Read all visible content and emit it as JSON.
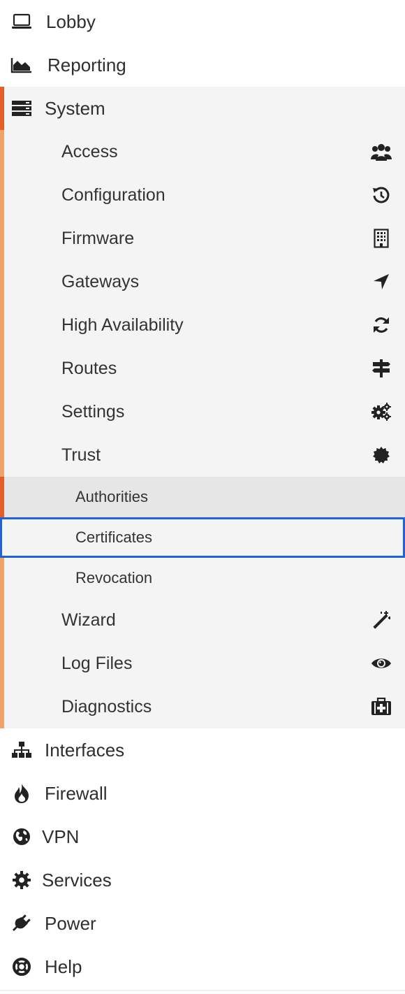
{
  "menu": {
    "top_items": [
      {
        "label": "Lobby",
        "icon": "laptop-icon"
      },
      {
        "label": "Reporting",
        "icon": "area-chart-icon"
      },
      {
        "label": "System",
        "icon": "server-icon"
      }
    ],
    "system_items": [
      {
        "label": "Access",
        "icon": "users-icon"
      },
      {
        "label": "Configuration",
        "icon": "history-icon"
      },
      {
        "label": "Firmware",
        "icon": "building-icon"
      },
      {
        "label": "Gateways",
        "icon": "location-arrow-icon"
      },
      {
        "label": "High Availability",
        "icon": "refresh-icon"
      },
      {
        "label": "Routes",
        "icon": "signpost-icon"
      },
      {
        "label": "Settings",
        "icon": "cogs-icon"
      },
      {
        "label": "Trust",
        "icon": "certificate-icon"
      }
    ],
    "trust_items": [
      {
        "label": "Authorities"
      },
      {
        "label": "Certificates"
      },
      {
        "label": "Revocation"
      }
    ],
    "system_items_after": [
      {
        "label": "Wizard",
        "icon": "magic-wand-icon"
      },
      {
        "label": "Log Files",
        "icon": "eye-icon"
      },
      {
        "label": "Diagnostics",
        "icon": "medkit-icon"
      }
    ],
    "bottom_items": [
      {
        "label": "Interfaces",
        "icon": "sitemap-icon"
      },
      {
        "label": "Firewall",
        "icon": "fire-icon"
      },
      {
        "label": "VPN",
        "icon": "globe-icon"
      },
      {
        "label": "Services",
        "icon": "cog-icon"
      },
      {
        "label": "Power",
        "icon": "plug-icon"
      },
      {
        "label": "Help",
        "icon": "life-ring-icon"
      }
    ]
  },
  "colors": {
    "accent_active": "#e25f2a",
    "accent_section": "#f0a369",
    "selection_outline": "#1f62e0",
    "submenu_bg": "#f4f4f4",
    "active_sub_bg": "#e6e6e6"
  }
}
